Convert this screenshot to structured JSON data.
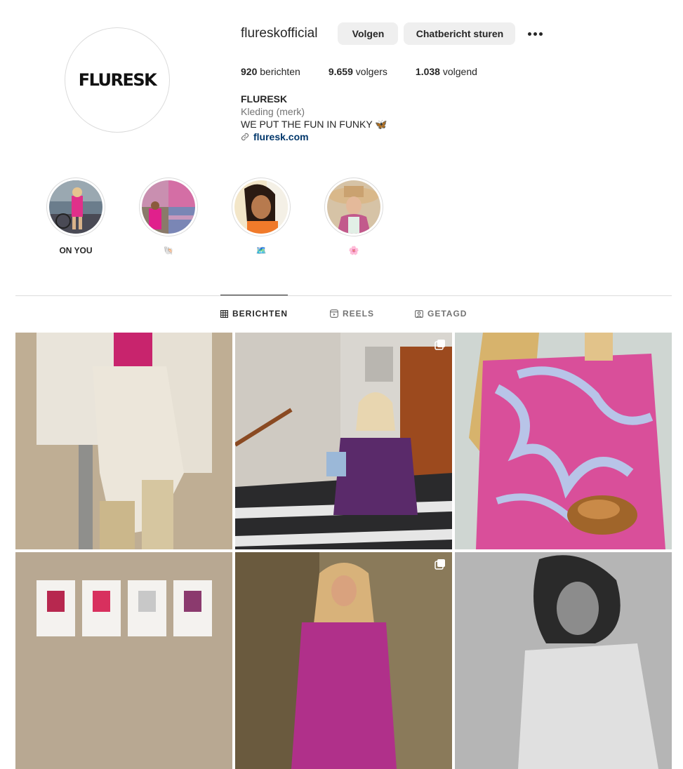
{
  "profile": {
    "username": "flureskofficial",
    "avatar_text": "FLURESK",
    "follow_label": "Volgen",
    "message_label": "Chatbericht sturen",
    "more_icon": "more-horizontal-icon"
  },
  "stats": {
    "posts_value": "920",
    "posts_label": "berichten",
    "followers_value": "9.659",
    "followers_label": "volgers",
    "following_value": "1.038",
    "following_label": "volgend"
  },
  "bio": {
    "name": "FLURESK",
    "category": "Kleding (merk)",
    "text": "WE PUT THE FUN IN FUNKY 🦋",
    "link": "fluresk.com"
  },
  "highlights": [
    {
      "label": "ON YOU"
    },
    {
      "label": "🐚"
    },
    {
      "label": "🗺️"
    },
    {
      "label": "🌸"
    }
  ],
  "tabs": {
    "posts": "BERICHTEN",
    "reels": "REELS",
    "tagged": "GETAGD"
  },
  "colors": {
    "link": "#00376b",
    "button_bg": "#efefef",
    "muted_text": "#737373",
    "border": "#dbdbdb"
  }
}
